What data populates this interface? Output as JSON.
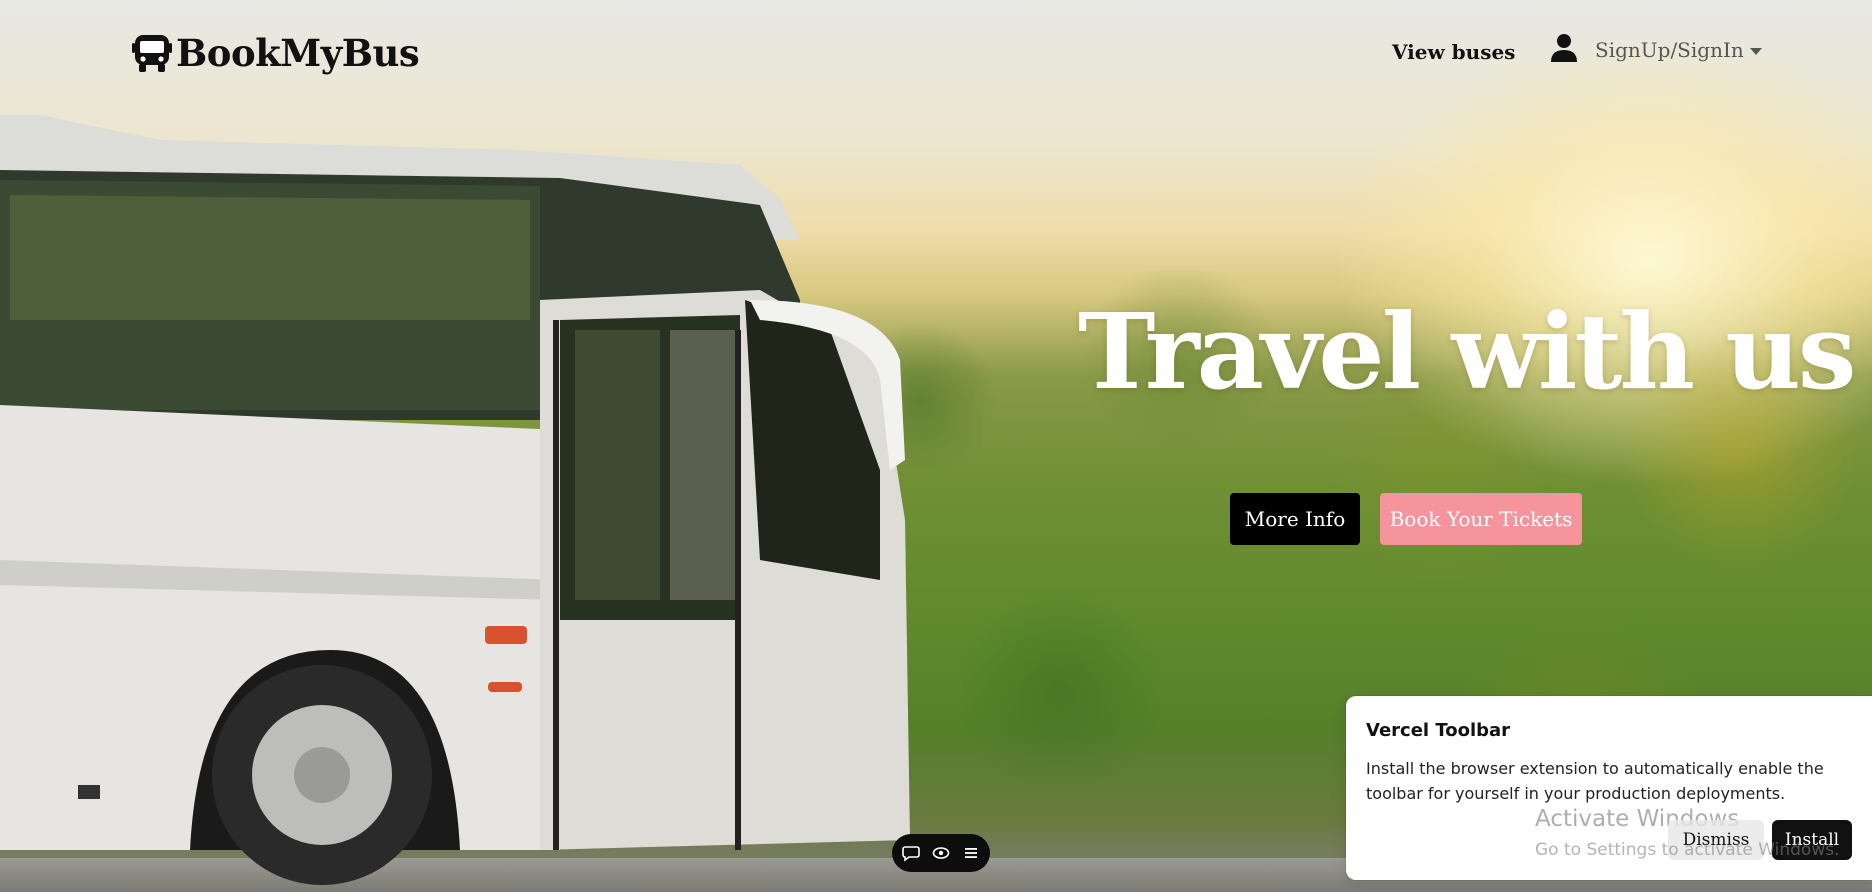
{
  "brand": {
    "name": "BookMyBus",
    "logo_icon": "bus-icon"
  },
  "nav": {
    "view_buses": "View buses",
    "account_icon": "user-icon",
    "signin_label": "SignUp/SignIn"
  },
  "hero": {
    "headline": "Travel with us",
    "more_info": "More Info",
    "book_tickets": "Book Your Tickets",
    "accent_color": "#f6949e"
  },
  "dev_toolbar": {
    "icons": [
      "comment-icon",
      "eye-icon",
      "menu-icon"
    ]
  },
  "vercel_toast": {
    "title": "Vercel Toolbar",
    "body": "Install the browser extension to automatically enable the toolbar for yourself in your production deployments.",
    "dismiss": "Dismiss",
    "install": "Install"
  },
  "windows_watermark": {
    "line1": "Activate Windows",
    "line2": "Go to Settings to activate Windows."
  }
}
